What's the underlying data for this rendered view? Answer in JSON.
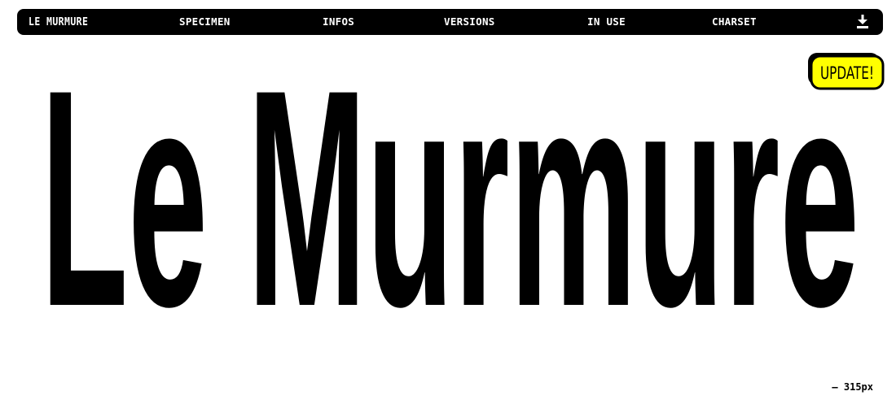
{
  "nav": {
    "brand": "LE MURMURE",
    "items": [
      {
        "label": "SPECIMEN"
      },
      {
        "label": "INFOS"
      },
      {
        "label": "VERSIONS"
      },
      {
        "label": "IN USE"
      },
      {
        "label": "CHARSET"
      }
    ],
    "download_icon": "download-icon"
  },
  "hero": {
    "title": "Le Murmure"
  },
  "badge": {
    "label": "UPDATE!",
    "color": "#ffff00"
  },
  "size_label": "— 315px"
}
